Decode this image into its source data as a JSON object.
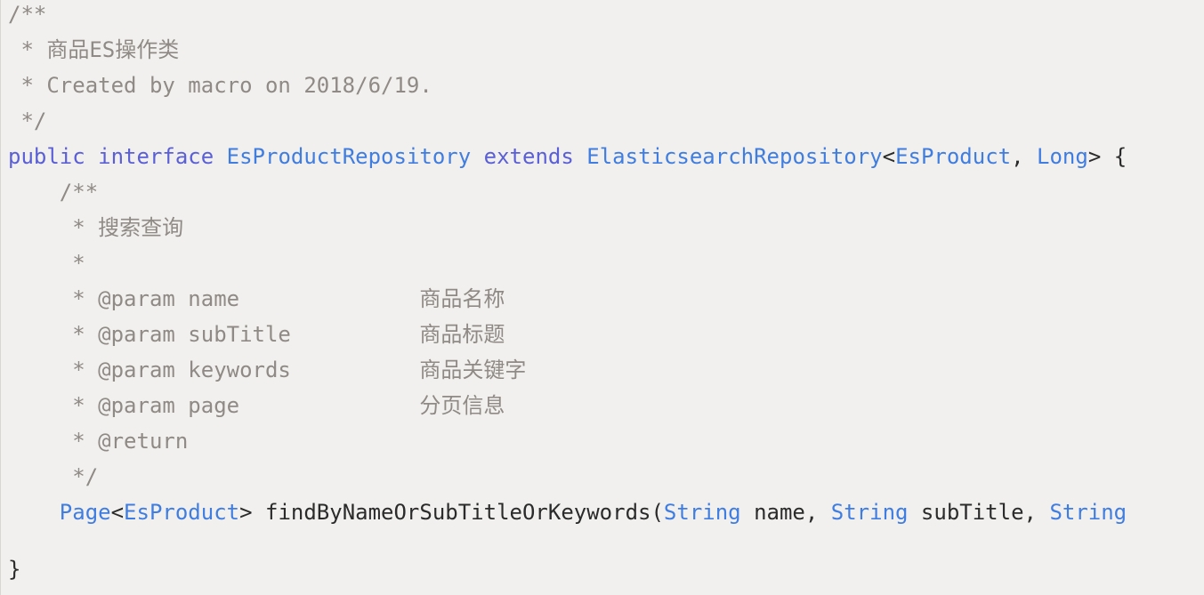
{
  "code": {
    "lines": [
      {
        "segments": [
          {
            "text": "/**",
            "kind": "comment"
          }
        ]
      },
      {
        "segments": [
          {
            "text": " * 商品ES操作类",
            "kind": "comment"
          }
        ]
      },
      {
        "segments": [
          {
            "text": " * Created by macro on 2018/6/19.",
            "kind": "comment"
          }
        ]
      },
      {
        "segments": [
          {
            "text": " */",
            "kind": "comment"
          }
        ]
      },
      {
        "segments": [
          {
            "text": "public",
            "kind": "keyword"
          },
          {
            "text": " ",
            "kind": "plain"
          },
          {
            "text": "interface",
            "kind": "keyword"
          },
          {
            "text": " ",
            "kind": "plain"
          },
          {
            "text": "EsProductRepository",
            "kind": "type"
          },
          {
            "text": " ",
            "kind": "plain"
          },
          {
            "text": "extends",
            "kind": "keyword"
          },
          {
            "text": " ",
            "kind": "plain"
          },
          {
            "text": "ElasticsearchRepository",
            "kind": "type"
          },
          {
            "text": "<",
            "kind": "plain"
          },
          {
            "text": "EsProduct",
            "kind": "type"
          },
          {
            "text": ", ",
            "kind": "plain"
          },
          {
            "text": "Long",
            "kind": "type"
          },
          {
            "text": "> {",
            "kind": "plain"
          }
        ]
      },
      {
        "segments": [
          {
            "text": "    /**",
            "kind": "comment"
          }
        ]
      },
      {
        "segments": [
          {
            "text": "     * 搜索查询",
            "kind": "comment"
          }
        ]
      },
      {
        "segments": [
          {
            "text": "     *",
            "kind": "comment"
          }
        ]
      },
      {
        "segments": [
          {
            "text": "     * @param name              商品名称",
            "kind": "comment"
          }
        ]
      },
      {
        "segments": [
          {
            "text": "     * @param subTitle          商品标题",
            "kind": "comment"
          }
        ]
      },
      {
        "segments": [
          {
            "text": "     * @param keywords          商品关键字",
            "kind": "comment"
          }
        ]
      },
      {
        "segments": [
          {
            "text": "     * @param page              分页信息",
            "kind": "comment"
          }
        ]
      },
      {
        "segments": [
          {
            "text": "     * @return",
            "kind": "comment"
          }
        ]
      },
      {
        "segments": [
          {
            "text": "     */",
            "kind": "comment"
          }
        ]
      },
      {
        "segments": [
          {
            "text": "    ",
            "kind": "plain"
          },
          {
            "text": "Page",
            "kind": "type"
          },
          {
            "text": "<",
            "kind": "plain"
          },
          {
            "text": "EsProduct",
            "kind": "type"
          },
          {
            "text": "> findByNameOrSubTitleOrKeywords(",
            "kind": "plain"
          },
          {
            "text": "String",
            "kind": "type"
          },
          {
            "text": " name, ",
            "kind": "plain"
          },
          {
            "text": "String",
            "kind": "type"
          },
          {
            "text": " subTitle, ",
            "kind": "plain"
          },
          {
            "text": "String",
            "kind": "type"
          }
        ]
      },
      {
        "segments": [
          {
            "text": "}",
            "kind": "plain"
          }
        ]
      }
    ],
    "colors": {
      "background": "#f1f0ee",
      "comment": "#8f8a85",
      "keyword": "#5a5fd6",
      "type": "#3f7de0",
      "plain": "#2b2b2b"
    }
  }
}
